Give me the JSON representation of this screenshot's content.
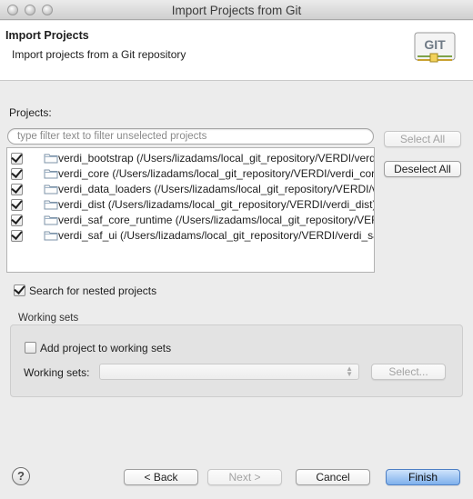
{
  "window": {
    "title": "Import Projects from Git"
  },
  "header": {
    "title": "Import Projects",
    "description": "Import projects from a Git repository",
    "logo_text": "GIT"
  },
  "projects": {
    "label": "Projects:",
    "filter_placeholder": "type filter text to filter unselected projects",
    "items": [
      {
        "label": "verdi_bootstrap (/Users/lizadams/local_git_repository/VERDI/verdi_bootstrap)",
        "checked": true
      },
      {
        "label": "verdi_core (/Users/lizadams/local_git_repository/VERDI/verdi_core)",
        "checked": true
      },
      {
        "label": "verdi_data_loaders (/Users/lizadams/local_git_repository/VERDI/verdi_data_loaders)",
        "checked": true
      },
      {
        "label": "verdi_dist (/Users/lizadams/local_git_repository/VERDI/verdi_dist)",
        "checked": true
      },
      {
        "label": "verdi_saf_core_runtime (/Users/lizadams/local_git_repository/VERDI/verdi_saf_core_runtime)",
        "checked": true
      },
      {
        "label": "verdi_saf_ui (/Users/lizadams/local_git_repository/VERDI/verdi_saf_ui)",
        "checked": true
      }
    ],
    "select_all_label": "Select All",
    "deselect_all_label": "Deselect All"
  },
  "nested": {
    "label": "Search for nested projects",
    "checked": true
  },
  "working_sets": {
    "group_label": "Working sets",
    "add_label": "Add project to working sets",
    "add_checked": false,
    "field_label": "Working sets:",
    "select_label": "Select..."
  },
  "footer": {
    "help_glyph": "?",
    "back_label": "< Back",
    "next_label": "Next >",
    "cancel_label": "Cancel",
    "finish_label": "Finish"
  },
  "colors": {
    "accent": "#7fb0ec",
    "window_bg": "#ececec"
  }
}
